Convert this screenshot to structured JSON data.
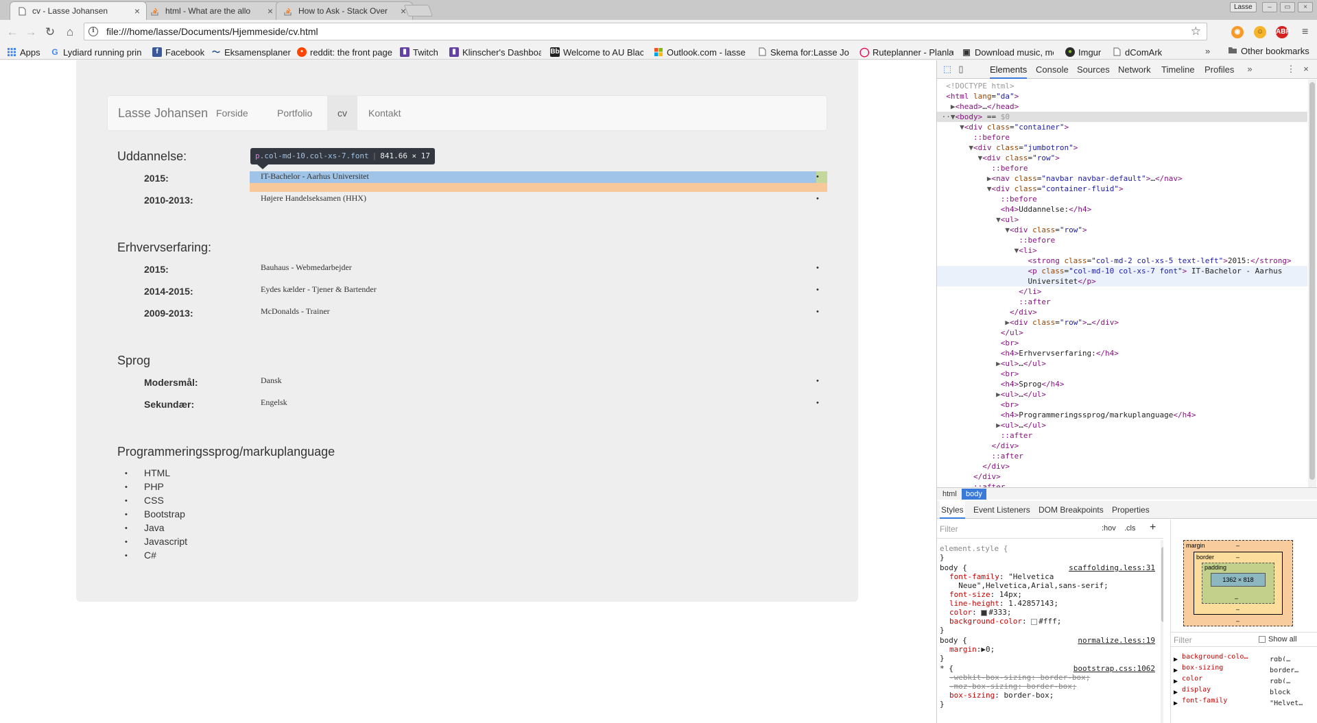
{
  "browser": {
    "tabs": [
      {
        "title": "cv - Lasse Johansen",
        "active": true
      },
      {
        "title": "html - What are the allo",
        "active": false
      },
      {
        "title": "How to Ask - Stack Over",
        "active": false
      }
    ],
    "profile_name": "Lasse",
    "url": "file:///home/lasse/Documents/Hjemmeside/cv.html",
    "bookmarks": [
      {
        "label": "Apps",
        "icon": "apps-grid-icon",
        "color": "#4285f4"
      },
      {
        "label": "Lydiard running princ",
        "icon": "google-icon",
        "color": "#4285f4"
      },
      {
        "label": "Facebook",
        "icon": "facebook-icon",
        "color": "#3b5998"
      },
      {
        "label": "Eksamensplaner",
        "icon": "eksamen-icon",
        "color": "#1a4a8a"
      },
      {
        "label": "reddit: the front page",
        "icon": "reddit-icon",
        "color": "#ff4500"
      },
      {
        "label": "Twitch",
        "icon": "twitch-icon",
        "color": "#6441a5"
      },
      {
        "label": "Klinscher's Dashboa",
        "icon": "twitch-icon",
        "color": "#6441a5"
      },
      {
        "label": "Welcome to AU Black",
        "icon": "blackboard-icon",
        "color": "#222222"
      },
      {
        "label": "Outlook.com - lasse_",
        "icon": "microsoft-icon",
        "color": "#f25022"
      },
      {
        "label": "Skema for:Lasse Joha",
        "icon": "page-icon",
        "color": "#888888"
      },
      {
        "label": "Ruteplanner - Planlæ",
        "icon": "rute-icon",
        "color": "#e5004f"
      },
      {
        "label": "Download music, mo",
        "icon": "download-icon",
        "color": "#333333"
      },
      {
        "label": "Imgur",
        "icon": "imgur-icon",
        "color": "#2b2b2b"
      },
      {
        "label": "dComArk",
        "icon": "page-icon",
        "color": "#888888"
      }
    ],
    "bookmarks_more": "»",
    "other_bookmarks": "Other bookmarks"
  },
  "page": {
    "navbar": {
      "brand": "Lasse Johansen",
      "links": [
        "Forside",
        "Portfolio",
        "cv",
        "Kontakt"
      ],
      "active": "cv"
    },
    "sections": [
      {
        "heading": "Uddannelse:",
        "rows": [
          {
            "label": "2015:",
            "value": "IT-Bachelor - Aarhus Universitet"
          },
          {
            "label": "2010-2013:",
            "value": "Højere Handelseksamen (HHX)"
          }
        ]
      },
      {
        "heading": "Erhvervserfaring:",
        "rows": [
          {
            "label": "2015:",
            "value": "Bauhaus - Webmedarbejder"
          },
          {
            "label": "2014-2015:",
            "value": "Eydes kælder - Tjener & Bartender"
          },
          {
            "label": "2009-2013:",
            "value": "McDonalds - Trainer"
          }
        ]
      },
      {
        "heading": "Sprog",
        "rows": [
          {
            "label": "Modersmål:",
            "value": "Dansk"
          },
          {
            "label": "Sekundær:",
            "value": "Engelsk"
          }
        ]
      }
    ],
    "languages_heading": "Programmeringssprog/markuplanguage",
    "languages": [
      "HTML",
      "PHP",
      "CSS",
      "Bootstrap",
      "Java",
      "Javascript",
      "C#"
    ],
    "bullet": "•",
    "inspect_tooltip": {
      "tag": "p",
      "classes": ".col-md-10.col-xs-7.font",
      "size": "841.66 × 17"
    }
  },
  "devtools": {
    "tabs": [
      "Elements",
      "Console",
      "Sources",
      "Network",
      "Timeline",
      "Profiles"
    ],
    "active_tab": "Elements",
    "breadcrumbs": [
      "html",
      "body"
    ],
    "sub_tabs": [
      "Styles",
      "Event Listeners",
      "DOM Breakpoints",
      "Properties"
    ],
    "filter_placeholder": "Filter",
    "hov": ":hov",
    "cls": ".cls",
    "box_model": {
      "margin": "margin",
      "border": "border",
      "padding": "padding",
      "content": "1362 × 818",
      "dash": "–"
    },
    "computed_filter": "Filter",
    "show_all": "Show all",
    "computed": [
      {
        "prop": "background-colo…",
        "value": "rgb(…"
      },
      {
        "prop": "box-sizing",
        "value": "border…"
      },
      {
        "prop": "color",
        "value": "rgb(…"
      },
      {
        "prop": "display",
        "value": "block"
      },
      {
        "prop": "font-family",
        "value": "\"Helvet…"
      }
    ],
    "css_sources": [
      "scaffolding.less:31",
      "normalize.less:19",
      "bootstrap.css:1062"
    ]
  }
}
